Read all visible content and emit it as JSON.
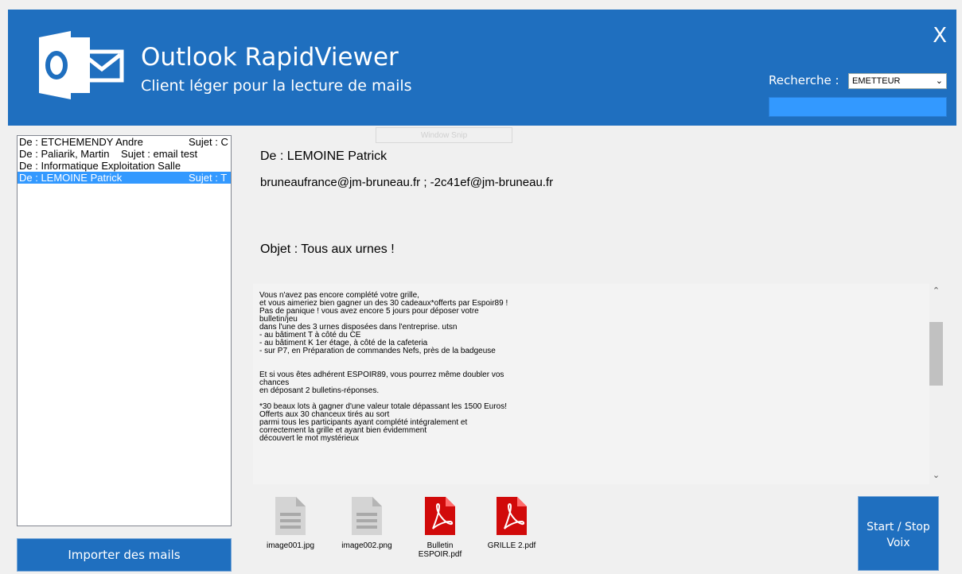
{
  "header": {
    "title": "Outlook RapidViewer",
    "subtitle": "Client léger pour la lecture de mails",
    "close_label": "X",
    "search_label": "Recherche :",
    "search_field_selected": "EMETTEUR",
    "search_value": ""
  },
  "overlay": {
    "snip_label": "Window Snip"
  },
  "mail_list": {
    "items": [
      {
        "from": "De : ETCHEMENDY Andre",
        "subject": "Sujet : C",
        "selected": false
      },
      {
        "from": "De : Paliarik, Martin",
        "subject": "Sujet : email test",
        "selected": false
      },
      {
        "from": "De : Informatique Exploitation Salle",
        "subject": "",
        "selected": false
      },
      {
        "from": "De : LEMOINE Patrick",
        "subject": "Sujet : T",
        "selected": true
      }
    ],
    "import_button": "Importer des mails"
  },
  "message": {
    "from": "De : LEMOINE Patrick",
    "to": "bruneaufrance@jm-bruneau.fr ; -2c41ef@jm-bruneau.fr",
    "subject": "Objet : Tous aux urnes !",
    "body_lines": [
      "Vous n'avez pas encore complété votre grille,",
      "et vous aimeriez bien gagner un des 30 cadeaux*offerts par Espoir89 !",
      "Pas de panique ! vous avez encore 5 jours pour déposer votre",
      "bulletin/jeu",
      "dans l'une des 3 urnes disposées dans l'entreprise. utsn",
      "- au bâtiment T à côté du CE",
      "- au bâtiment K 1er étage, à côté de la cafeteria",
      "- sur P7, en Préparation de commandes Nefs, près de la badgeuse",
      "",
      "",
      "Et si vous êtes adhérent ESPOIR89, vous pourrez même doubler vos",
      "chances",
      "en déposant 2 bulletins-réponses.",
      "",
      "*30 beaux lots à gagner d'une valeur totale dépassant les 1500 Euros!",
      "Offerts aux 30 chanceux tirés au sort",
      "parmi tous les participants ayant complété intégralement et",
      "correctement la grille et ayant bien évidemment",
      "découvert le mot mystérieux"
    ]
  },
  "attachments": [
    {
      "name": "image001.jpg",
      "icon": "image-file-icon"
    },
    {
      "name": "image002.png",
      "icon": "image-file-icon"
    },
    {
      "name": "Bulletin ESPOIR.pdf",
      "icon": "pdf-file-icon"
    },
    {
      "name": "GRILLE 2.pdf",
      "icon": "pdf-file-icon"
    }
  ],
  "voice_button": "Start / Stop Voix",
  "colors": {
    "header_bg": "#1f6fbf",
    "selection": "#3399ff",
    "pdf_red": "#d10a0a"
  }
}
